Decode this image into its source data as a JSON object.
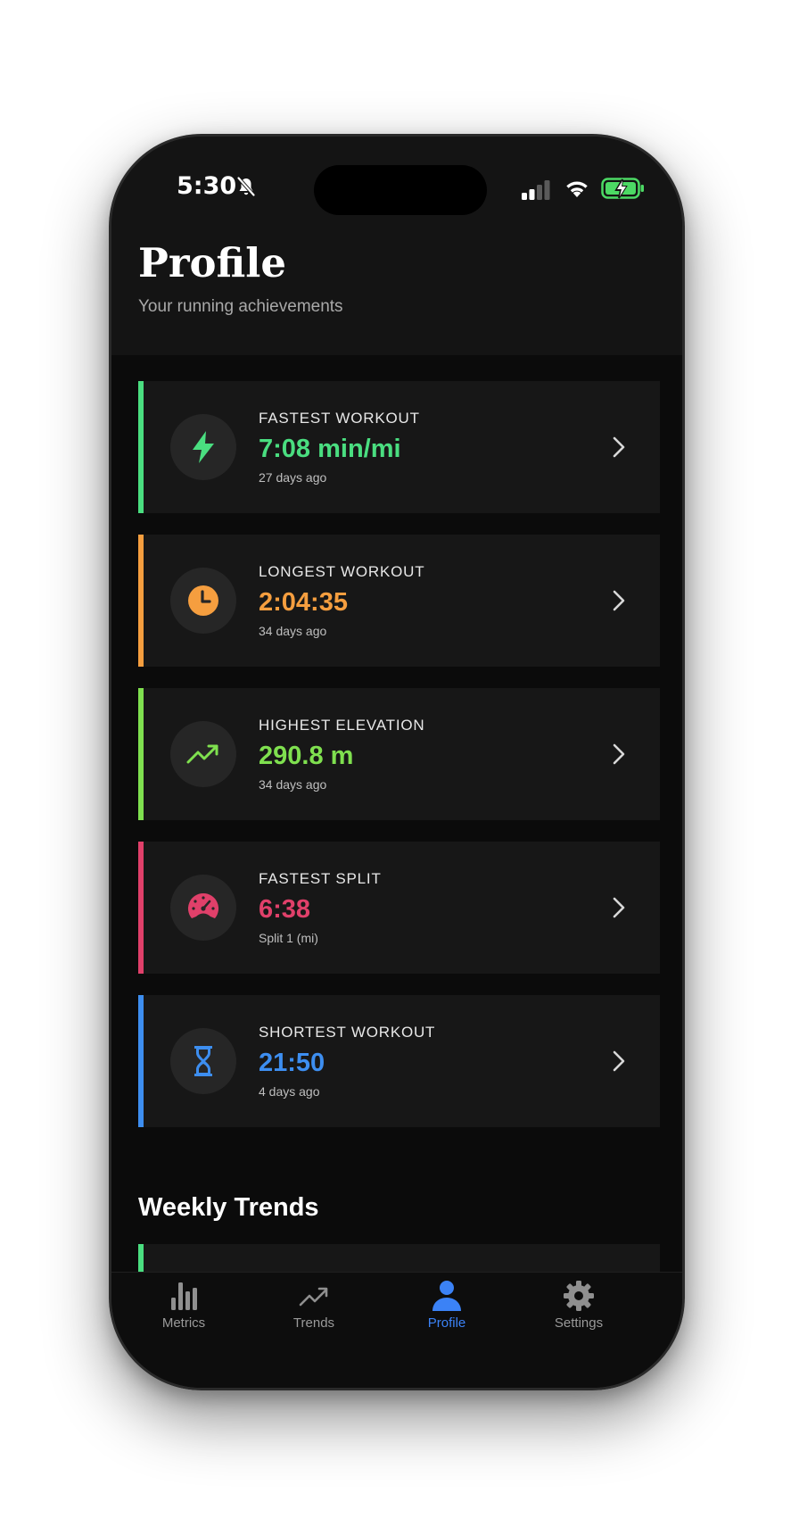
{
  "status_bar": {
    "time": "5:30",
    "icons": [
      "bell-slash-icon",
      "signal-icon",
      "wifi-icon",
      "battery-charging-icon"
    ]
  },
  "header": {
    "title": "Profile",
    "subtitle": "Your running achievements"
  },
  "achievements": [
    {
      "label": "FASTEST WORKOUT",
      "value": "7:08 min/mi",
      "sub": "27 days ago",
      "color": "#4ade80",
      "icon": "bolt-icon"
    },
    {
      "label": "LONGEST WORKOUT",
      "value": "2:04:35",
      "sub": "34 days ago",
      "color": "#f59e3f",
      "icon": "clock-icon"
    },
    {
      "label": "HIGHEST ELEVATION",
      "value": "290.8 m",
      "sub": "34 days ago",
      "color": "#7fe04f",
      "icon": "trending-up-icon"
    },
    {
      "label": "FASTEST SPLIT",
      "value": "6:38",
      "sub": "Split 1 (mi)",
      "color": "#e0406a",
      "icon": "speedometer-icon"
    },
    {
      "label": "SHORTEST WORKOUT",
      "value": "21:50",
      "sub": "4 days ago",
      "color": "#3d8ef0",
      "icon": "hourglass-icon"
    }
  ],
  "weekly_trends": {
    "title": "Weekly Trends"
  },
  "tabs": [
    {
      "label": "Metrics",
      "icon": "bar-chart-icon",
      "active": false
    },
    {
      "label": "Trends",
      "icon": "trending-up-icon",
      "active": false
    },
    {
      "label": "Profile",
      "icon": "person-icon",
      "active": true
    },
    {
      "label": "Settings",
      "icon": "gear-icon",
      "active": false
    }
  ],
  "colors": {
    "active_tab": "#3b82f6",
    "background": "#0b0b0b",
    "card": "#171717"
  }
}
